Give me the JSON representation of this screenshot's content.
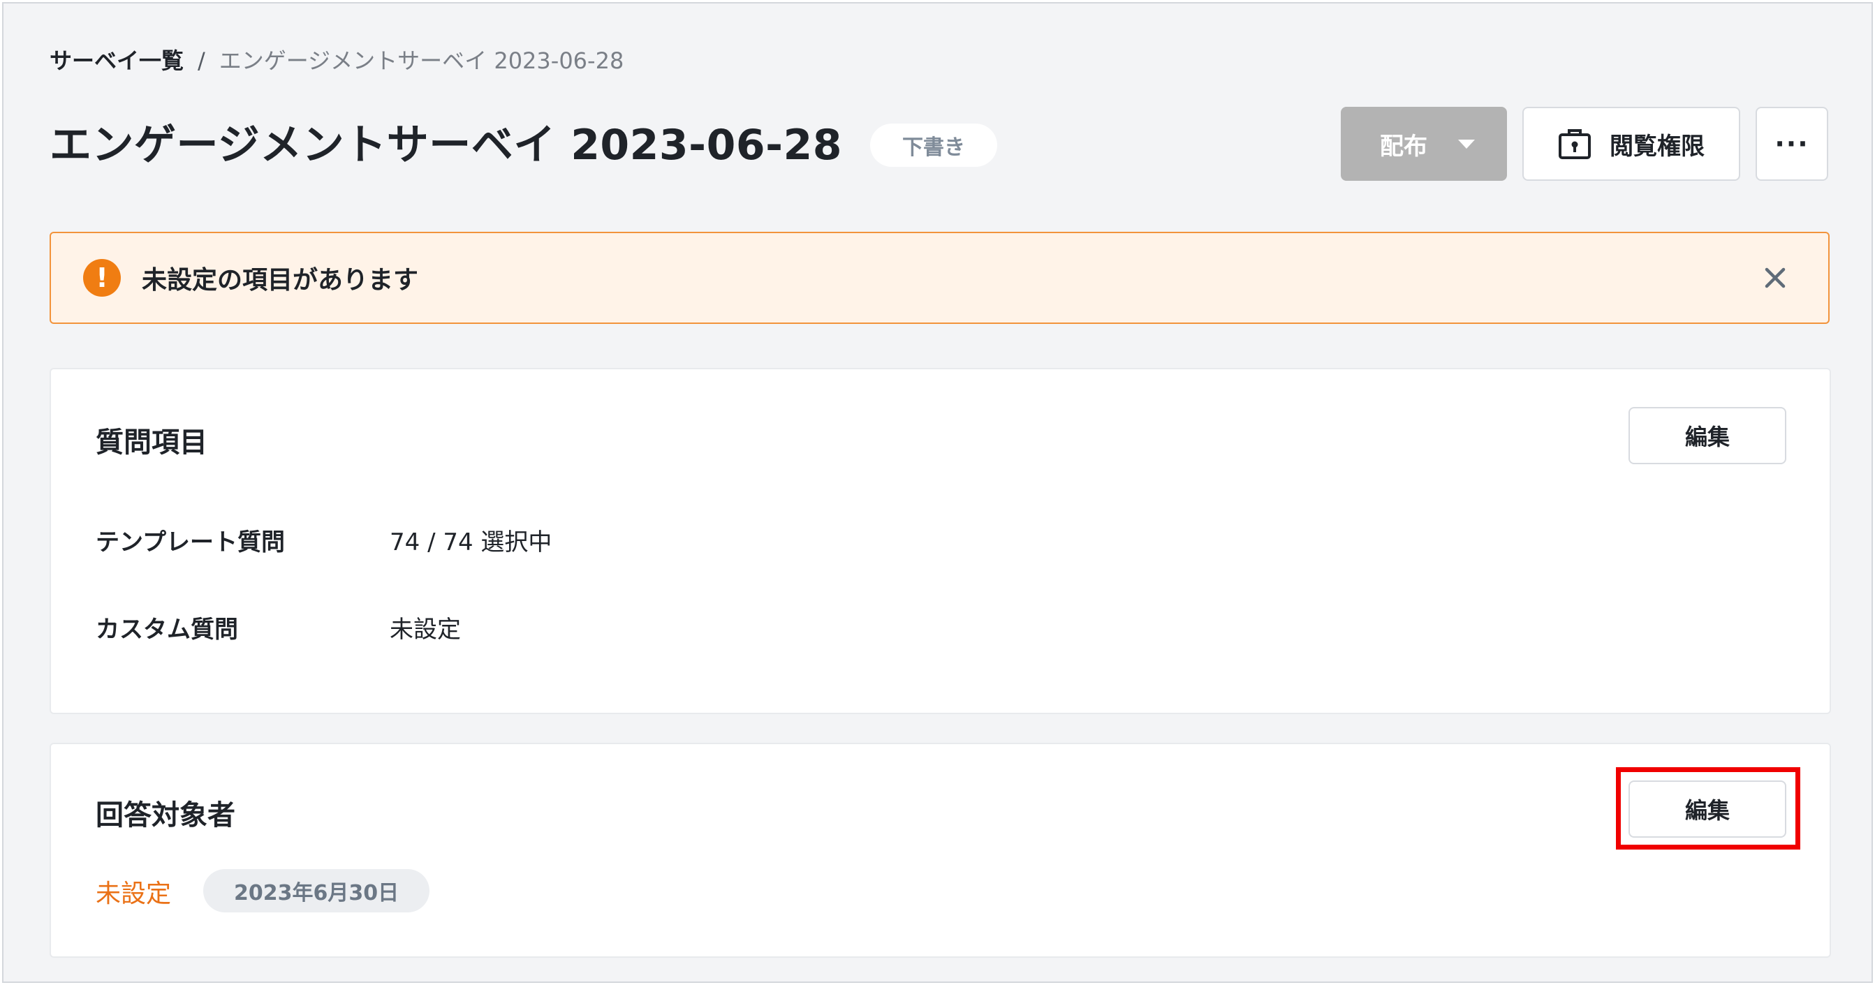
{
  "breadcrumb": {
    "parent": "サーベイ一覧",
    "separator": "/",
    "current": "エンゲージメントサーベイ 2023-06-28"
  },
  "header": {
    "title": "エンゲージメントサーベイ 2023-06-28",
    "status_badge": "下書き",
    "distribute_button": "配布",
    "permission_button": "閲覧権限",
    "more_button": "···"
  },
  "alert": {
    "icon": "exclamation-icon",
    "icon_glyph": "!",
    "message": "未設定の項目があります",
    "close_icon": "close-icon",
    "color": "#f07d12"
  },
  "questions_card": {
    "title": "質問項目",
    "edit_button": "編集",
    "rows": [
      {
        "label": "テンプレート質問",
        "value": "74 / 74 選択中"
      },
      {
        "label": "カスタム質問",
        "value": "未設定"
      }
    ]
  },
  "respondents_card": {
    "title": "回答対象者",
    "edit_button": "編集",
    "status": "未設定",
    "status_color": "#ea7116",
    "date": "2023年6月30日"
  },
  "highlight_color": "#f00000"
}
